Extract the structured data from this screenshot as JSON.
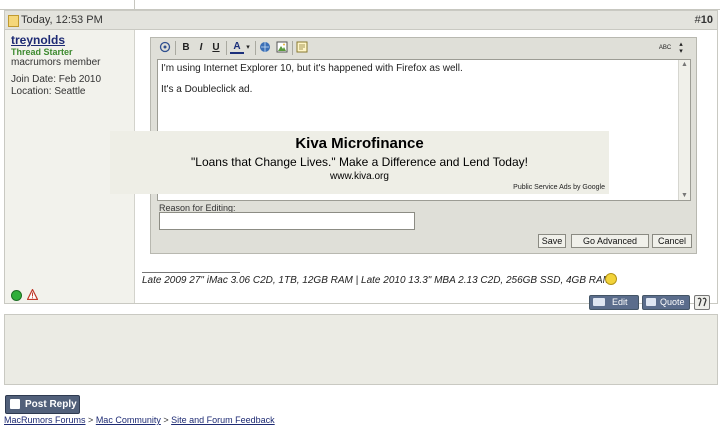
{
  "post": {
    "date": "Today, 12:53 PM",
    "number_prefix": "#",
    "number": "10"
  },
  "user": {
    "name": "treynolds",
    "starter": "Thread Starter",
    "title": "macrumors member",
    "join": "Join Date: Feb 2010",
    "location": "Location: Seattle"
  },
  "editor": {
    "toolbar": {
      "bold": "B",
      "italic": "I",
      "underline": "U",
      "font_color": "A",
      "spell": "ABC"
    },
    "line1": "I'm using Internet Explorer 10, but it's happened with Firefox as well.",
    "line2": "It's a Doubleclick ad.",
    "reason_label": "Reason for Editing:",
    "save": "Save",
    "go_advanced": "Go Advanced",
    "cancel": "Cancel"
  },
  "ad": {
    "title": "Kiva Microfinance",
    "tagline": "\"Loans that Change Lives.\" Make a Difference and Lend Today!",
    "url": "www.kiva.org",
    "psa": "Public Service Ads by Google"
  },
  "signature": "Late 2009 27\" iMac 3.06 C2D, 1TB, 12GB RAM | Late 2010 13.3\" MBA 2.13 C2D, 256GB SSD, 4GB RAM",
  "post_buttons": {
    "edit": "Edit",
    "quote": "Quote"
  },
  "post_reply": "Post Reply",
  "breadcrumb": {
    "item1": "MacRumors Forums",
    "item2": "Mac Community",
    "item3": "Site and Forum Feedback",
    "sep": ">"
  },
  "colors": {
    "header_bg": "#e3e3dd",
    "user_link": "#1d2a73",
    "starter_green": "#3d8a2f",
    "button_blue": "#51607a"
  }
}
